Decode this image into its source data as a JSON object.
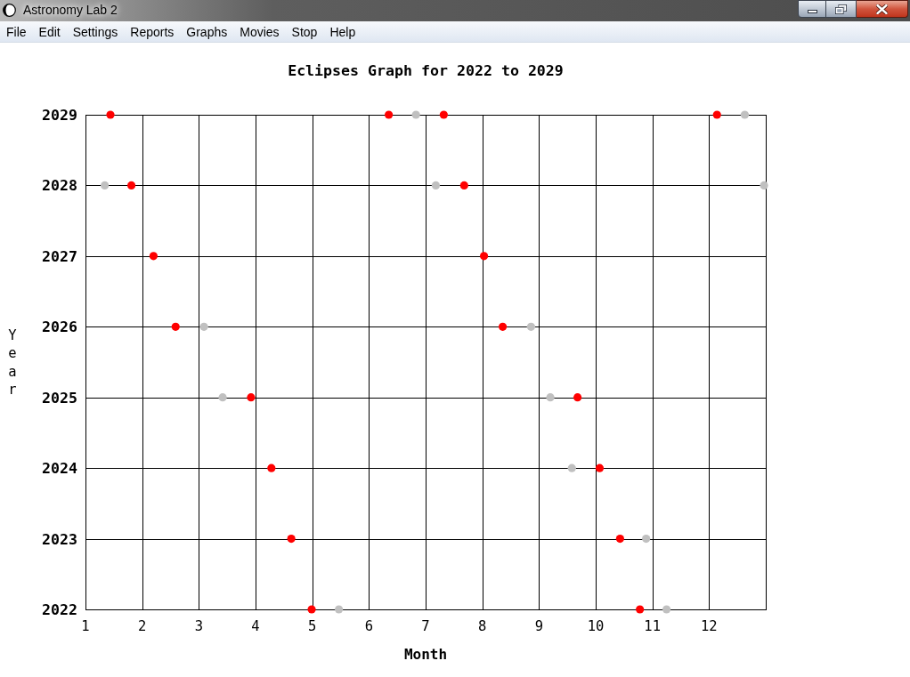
{
  "window": {
    "title": "Astronomy Lab 2"
  },
  "menu": [
    "File",
    "Edit",
    "Settings",
    "Reports",
    "Graphs",
    "Movies",
    "Stop",
    "Help"
  ],
  "graph": {
    "chart_data": {
      "type": "scatter",
      "title": "Eclipses Graph for 2022 to 2029",
      "xlabel": "Month",
      "ylabel": "Year",
      "xlim": [
        1,
        13
      ],
      "ylim": [
        2022,
        2029
      ],
      "xticks": [
        1,
        2,
        3,
        4,
        5,
        6,
        7,
        8,
        9,
        10,
        11,
        12
      ],
      "yticks": [
        2022,
        2023,
        2024,
        2025,
        2026,
        2027,
        2028,
        2029
      ],
      "grid": true,
      "series": [
        {
          "color": "#ff0000",
          "x": [
            4.99,
            10.78,
            4.63,
            10.43,
            4.28,
            10.07,
            3.92,
            9.68,
            2.59,
            8.36,
            2.2,
            8.03,
            1.81,
            7.68,
            1.44,
            6.35,
            7.32,
            12.14
          ],
          "values": [
            2022,
            2022,
            2023,
            2023,
            2024,
            2024,
            2025,
            2025,
            2026,
            2026,
            2027,
            2027,
            2028,
            2028,
            2029,
            2029,
            2029,
            2029
          ]
        },
        {
          "color": "#c0c0c0",
          "x": [
            5.47,
            11.25,
            10.89,
            9.58,
            3.42,
            9.2,
            3.09,
            8.86,
            1.34,
            7.18,
            12.97,
            6.83,
            12.63
          ],
          "values": [
            2022,
            2022,
            2023,
            2024,
            2025,
            2025,
            2026,
            2026,
            2028,
            2028,
            2028,
            2029,
            2029
          ]
        }
      ]
    }
  }
}
